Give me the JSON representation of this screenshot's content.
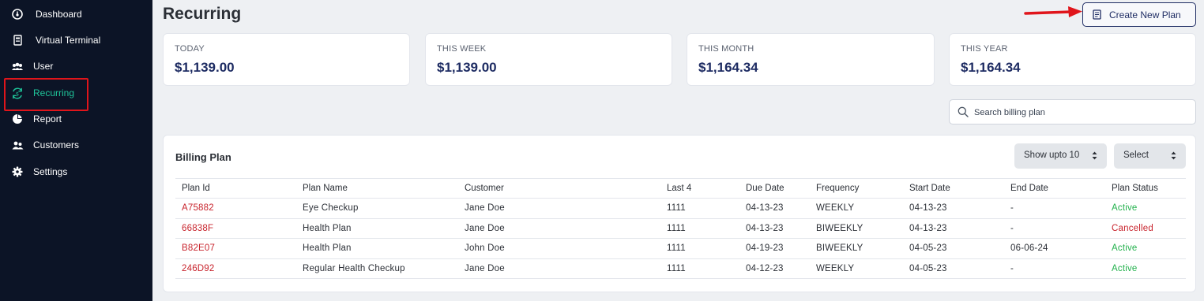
{
  "sidebar": {
    "items": [
      {
        "label": "Dashboard",
        "icon": "dashboard-icon"
      },
      {
        "label": "Virtual Terminal",
        "icon": "terminal-icon"
      },
      {
        "label": "User",
        "icon": "users-icon"
      },
      {
        "label": "Recurring",
        "icon": "recurring-icon",
        "active": true
      },
      {
        "label": "Report",
        "icon": "pie-chart-icon"
      },
      {
        "label": "Customers",
        "icon": "customers-icon"
      },
      {
        "label": "Settings",
        "icon": "gear-icon"
      }
    ]
  },
  "header": {
    "title": "Recurring",
    "create_label": "Create New Plan"
  },
  "stats": [
    {
      "label": "TODAY",
      "value": "$1,139.00"
    },
    {
      "label": "THIS WEEK",
      "value": "$1,139.00"
    },
    {
      "label": "THIS MONTH",
      "value": "$1,164.34"
    },
    {
      "label": "THIS YEAR",
      "value": "$1,164.34"
    }
  ],
  "search": {
    "placeholder": "Search billing plan"
  },
  "panel": {
    "title": "Billing Plan",
    "show_label": "Show upto 10",
    "select_label": "Select"
  },
  "table": {
    "headers": [
      "Plan Id",
      "Plan Name",
      "Customer",
      "Last 4",
      "Due Date",
      "Frequency",
      "Start Date",
      "End Date",
      "Plan Status"
    ],
    "rows": [
      [
        "A75882",
        "Eye Checkup",
        "Jane Doe",
        "1111",
        "04-13-23",
        "WEEKLY",
        "04-13-23",
        "-",
        "Active"
      ],
      [
        "66838F",
        "Health Plan",
        "Jane Doe",
        "1111",
        "04-13-23",
        "BIWEEKLY",
        "04-13-23",
        "-",
        "Cancelled"
      ],
      [
        "B82E07",
        "Health Plan",
        "John Doe",
        "1111",
        "04-19-23",
        "BIWEEKLY",
        "04-05-23",
        "06-06-24",
        "Active"
      ],
      [
        "246D92",
        "Regular Health Checkup",
        "Jane Doe",
        "1111",
        "04-12-23",
        "WEEKLY",
        "04-05-23",
        "-",
        "Active"
      ]
    ]
  },
  "colors": {
    "sidebar_bg": "#0c1426",
    "active_nav": "#1fc59a",
    "brand_navy": "#1e2c63",
    "plan_id_red": "#c8232c",
    "status_active": "#22b14c",
    "status_cancelled": "#c8232c",
    "highlight_red": "#e0151b"
  }
}
